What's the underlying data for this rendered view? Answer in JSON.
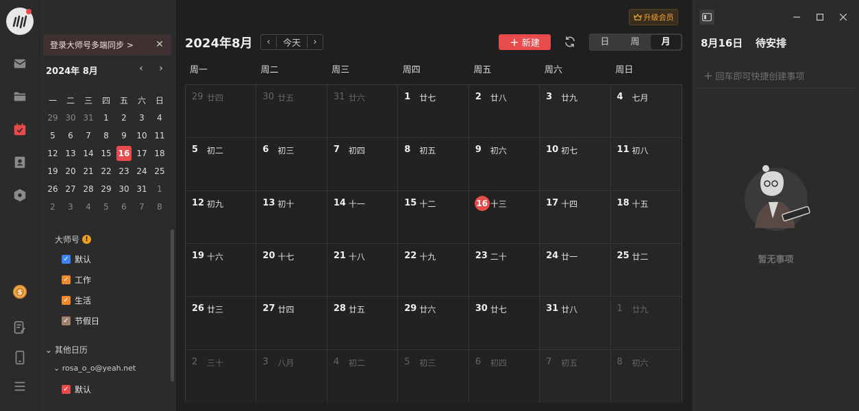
{
  "rail": {
    "items": [
      {
        "name": "mail-icon"
      },
      {
        "name": "folder-icon"
      },
      {
        "name": "calendar-icon",
        "active": true
      },
      {
        "name": "contacts-icon"
      },
      {
        "name": "hexagon-icon"
      }
    ],
    "bottom": [
      {
        "name": "coin-icon"
      },
      {
        "name": "notes-icon"
      },
      {
        "name": "phone-icon"
      },
      {
        "name": "menu-icon"
      }
    ]
  },
  "side": {
    "sync_banner": "登录大师号多端同步 >",
    "mini_title": "2024年 8月",
    "weekdays": [
      "一",
      "二",
      "三",
      "四",
      "五",
      "六",
      "日"
    ],
    "weeks": [
      [
        "29",
        "30",
        "31",
        "1",
        "2",
        "3",
        "4"
      ],
      [
        "5",
        "6",
        "7",
        "8",
        "9",
        "10",
        "11"
      ],
      [
        "12",
        "13",
        "14",
        "15",
        "16",
        "17",
        "18"
      ],
      [
        "19",
        "20",
        "21",
        "22",
        "23",
        "24",
        "25"
      ],
      [
        "26",
        "27",
        "28",
        "29",
        "30",
        "31",
        "1"
      ],
      [
        "2",
        "3",
        "4",
        "5",
        "6",
        "7",
        "8"
      ]
    ],
    "group_label": "大师号",
    "warn": "!",
    "calendars": [
      {
        "label": "默认",
        "color": "#3b82f6"
      },
      {
        "label": "工作",
        "color": "#f0892b"
      },
      {
        "label": "生活",
        "color": "#f0892b"
      },
      {
        "label": "节假日",
        "color": "#a08070"
      }
    ],
    "other_label": "其他日历",
    "account": "rosa_o_o@yeah.net",
    "account_calendars": [
      {
        "label": "默认",
        "color": "#e84b4b"
      }
    ]
  },
  "main": {
    "upgrade": "升级会员",
    "title": "2024年8月",
    "today_btn": "今天",
    "new_btn": "新建",
    "views": [
      "日",
      "周",
      "月"
    ],
    "active_view": "月",
    "weekday_headers": [
      "周一",
      "周二",
      "周三",
      "周四",
      "周五",
      "周六",
      "周日"
    ],
    "weeks": [
      [
        {
          "d": "29",
          "l": "廿四",
          "dim": true
        },
        {
          "d": "30",
          "l": "廿五",
          "dim": true
        },
        {
          "d": "31",
          "l": "廿六",
          "dim": true
        },
        {
          "d": "1",
          "l": "廿七"
        },
        {
          "d": "2",
          "l": "廿八"
        },
        {
          "d": "3",
          "l": "廿九"
        },
        {
          "d": "4",
          "l": "七月"
        }
      ],
      [
        {
          "d": "5",
          "l": "初二"
        },
        {
          "d": "6",
          "l": "初三"
        },
        {
          "d": "7",
          "l": "初四"
        },
        {
          "d": "8",
          "l": "初五"
        },
        {
          "d": "9",
          "l": "初六"
        },
        {
          "d": "10",
          "l": "初七"
        },
        {
          "d": "11",
          "l": "初八"
        }
      ],
      [
        {
          "d": "12",
          "l": "初九"
        },
        {
          "d": "13",
          "l": "初十"
        },
        {
          "d": "14",
          "l": "十一"
        },
        {
          "d": "15",
          "l": "十二"
        },
        {
          "d": "16",
          "l": "十三",
          "today": true
        },
        {
          "d": "17",
          "l": "十四"
        },
        {
          "d": "18",
          "l": "十五"
        }
      ],
      [
        {
          "d": "19",
          "l": "十六"
        },
        {
          "d": "20",
          "l": "十七"
        },
        {
          "d": "21",
          "l": "十八"
        },
        {
          "d": "22",
          "l": "十九"
        },
        {
          "d": "23",
          "l": "二十"
        },
        {
          "d": "24",
          "l": "廿一"
        },
        {
          "d": "25",
          "l": "廿二"
        }
      ],
      [
        {
          "d": "26",
          "l": "廿三"
        },
        {
          "d": "27",
          "l": "廿四"
        },
        {
          "d": "28",
          "l": "廿五"
        },
        {
          "d": "29",
          "l": "廿六"
        },
        {
          "d": "30",
          "l": "廿七"
        },
        {
          "d": "31",
          "l": "廿八"
        },
        {
          "d": "1",
          "l": "廿九",
          "dim": true
        }
      ],
      [
        {
          "d": "2",
          "l": "三十",
          "dim": true
        },
        {
          "d": "3",
          "l": "八月",
          "dim": true
        },
        {
          "d": "4",
          "l": "初二",
          "dim": true
        },
        {
          "d": "5",
          "l": "初三",
          "dim": true
        },
        {
          "d": "6",
          "l": "初四",
          "dim": true
        },
        {
          "d": "7",
          "l": "初五",
          "dim": true
        },
        {
          "d": "8",
          "l": "初六",
          "dim": true
        }
      ]
    ]
  },
  "right": {
    "date_title": "8月16日",
    "pending_title": "待安排",
    "quick_add": "回车即可快捷创建事项",
    "empty_text": "暂无事项"
  },
  "colors": {
    "accent": "#e84b4b",
    "upgrade": "#f0a33b"
  }
}
